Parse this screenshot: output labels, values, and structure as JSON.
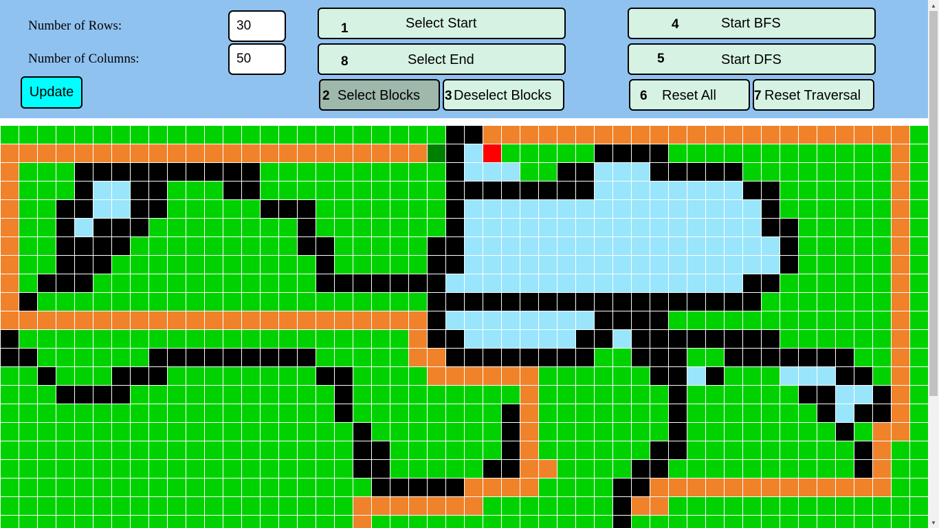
{
  "controls": {
    "rows_label": "Number of Rows:",
    "rows_value": "30",
    "cols_label": "Number of Columns:",
    "cols_value": "50",
    "update_label": "Update"
  },
  "buttons": {
    "select_start": {
      "key": "1",
      "label": "Select Start"
    },
    "select_end": {
      "key": "8",
      "label": "Select End"
    },
    "select_blocks": {
      "key": "2",
      "label": "Select Blocks"
    },
    "deselect_blocks": {
      "key": "3",
      "label": "Deselect Blocks"
    },
    "start_bfs": {
      "key": "4",
      "label": "Start BFS"
    },
    "start_dfs": {
      "key": "5",
      "label": "Start DFS"
    },
    "reset_all": {
      "key": "6",
      "label": "Reset All"
    },
    "reset_traversal": {
      "key": "7",
      "label": "Reset Traversal"
    }
  },
  "colors": {
    "panel": "#90c2f0",
    "cell_default": "#00d200",
    "wall": "#000000",
    "path": "#f0822a",
    "visited": "#99e5fb",
    "start": "#008000",
    "end": "#ff0000",
    "button_bg": "#d6f2e3",
    "button_active": "#9eb8ac",
    "update_bg": "#00ffff"
  },
  "grid": {
    "rows": 30,
    "cols": 50,
    "legend": "G=unvisited, B=wall, O=path, L=visited, S=start, E=end",
    "cells": [
      "GGGGGGGGGGGGGGGGGGGGGGGGBBOOOOOOOOOOOOOOOOOOOOOOOG",
      "OOOOOOOOOOOOOOOOOOOOOOOSBLEGGGGGBBBBGGGGGGGGGGGGOG",
      "OGGGBBBBBBBBBBGGGGGGGGGGBLLLGGBBLLLBBBBBGGGGGGGGOG",
      "OGGGBLLBBGGGBBGGGGGGGGGGBBBBBBBBLLLLLLLLBBGGGGGGOG",
      "OGGBBLLBBGGGGGBBBGGGGGGGBLLLLLLLLLLLLLLLLBGGGGGGOG",
      "OGGBLBBBGGGGGGGGBGGGGGGGBLLLLLLLLLLLLLLLLBBGGGGGOG",
      "OGGBBBBGGGGGGGGGBBGGGGGBBLLLLLLLLLLLLLLLLLBGGGGGOG",
      "OGGBBBGGGGGGGGGGGBGGGGGBBLLLLLLLLLLLLLLLLLBGGGGGOG",
      "OGBBBGGGGGGGGGGGGBBBBBBBLLLLLLLLLLLLLLLLBBGGGGGGOG",
      "OBGGGGGGGGGGGGGGGGGGGGGBBBBBBBBBBBBBBBBBBGGGGGGGOG",
      "OOOOOOOOOOOOOOOOOOOOOOOBLLLLLLLLBBBBGGGGGGGGGGGGOG",
      "BGGGGGGGGGGGGGGGGGGGGGOBBLLLLLLBBLBBBBBBBBGGGGGGOG",
      "BBGGGGGGBBBBBBBBBGGGGGOOBBBBBBBBGGBBBGGBBBBBBBGGOG",
      "GGBGGGBBBGGGGGGGGBBGGGGOOOOOOGGGGGGBBLBGGGLLLBBGOG",
      "GGGBBBBGGGGGGGGGGGBGGGGGGGGGOGGGGGGGBGGGGGGBBLLBOG",
      "GGGGGGGGGGGGGGGGGGBGGGGGGGGBOGGGGGGGBGGGGGGGBLBBOG",
      "GGGGGGGGGGGGGGGGGGGBGGGGGGGBOGGGGGGGBGGGGGGGGBGOOG",
      "GGGGGGGGGGGGGGGGGGGBBGGGGGGBOGGGGGGBBGGGGGGGGGBOGG",
      "GGGGGGGGGGGGGGGGGGGBBGGGGGBBOOGGGGBBGGGGGGGGGGBOGG",
      "GGGGGGGGGGGGGGGGGGGGBBBBBOOOOGGGGBBOOOOOOOOOOOOOGG",
      "GGGGGGGGGGGGGGGGGGGOOOOOOOGGGGGGGBOOGGGGGGGGGGGGGG",
      "GGGGGGGGGGGGGGGGGGGOGGGGGGGGGGGGGBGGGGGGGGGGGGGGGG"
    ]
  }
}
